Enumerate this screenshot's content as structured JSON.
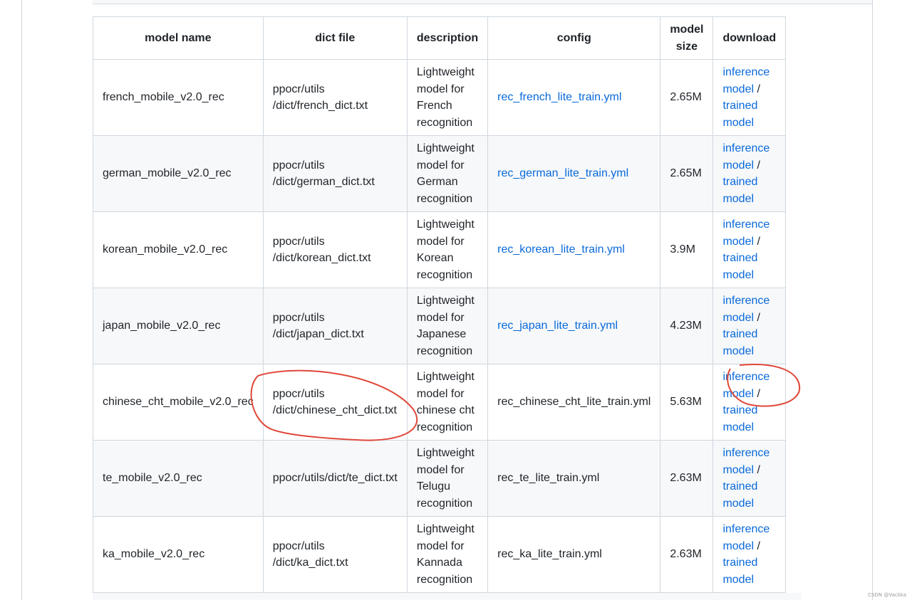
{
  "table": {
    "headers": {
      "model_name": "model name",
      "dict_file": "dict file",
      "description": "description",
      "config": "config",
      "model_size_1": "model",
      "model_size_2": "size",
      "download": "download"
    },
    "rows": [
      {
        "name": "french_mobile_v2.0_rec",
        "dict_1": "ppocr/utils",
        "dict_2": "/dict/french_dict.txt",
        "desc_1": "Lightweight",
        "desc_2": "model for",
        "desc_3": "French",
        "desc_4": "recognition",
        "config": "rec_french_lite_train.yml",
        "size": "2.65M",
        "dl_inference_1": "inference",
        "dl_inference_2": "model",
        "dl_sep": " /",
        "dl_trained_1": "trained",
        "dl_trained_2": "model"
      },
      {
        "name": "german_mobile_v2.0_rec",
        "dict_1": "ppocr/utils",
        "dict_2": "/dict/german_dict.txt",
        "desc_1": "Lightweight",
        "desc_2": "model for",
        "desc_3": "German",
        "desc_4": "recognition",
        "config": "rec_german_lite_train.yml",
        "size": "2.65M",
        "dl_inference_1": "inference",
        "dl_inference_2": "model",
        "dl_sep": " /",
        "dl_trained_1": "trained",
        "dl_trained_2": "model"
      },
      {
        "name": "korean_mobile_v2.0_rec",
        "dict_1": "ppocr/utils",
        "dict_2": "/dict/korean_dict.txt",
        "desc_1": "Lightweight",
        "desc_2": "model for",
        "desc_3": "Korean",
        "desc_4": "recognition",
        "config": "rec_korean_lite_train.yml",
        "size": "3.9M",
        "dl_inference_1": "inference",
        "dl_inference_2": "model",
        "dl_sep": " /",
        "dl_trained_1": "trained",
        "dl_trained_2": "model"
      },
      {
        "name": "japan_mobile_v2.0_rec",
        "dict_1": "ppocr/utils",
        "dict_2": "/dict/japan_dict.txt",
        "desc_1": "Lightweight",
        "desc_2": "model for",
        "desc_3": "Japanese",
        "desc_4": "recognition",
        "config": "rec_japan_lite_train.yml",
        "size": "4.23M",
        "dl_inference_1": "inference",
        "dl_inference_2": "model",
        "dl_sep": " /",
        "dl_trained_1": "trained",
        "dl_trained_2": "model"
      },
      {
        "name": "chinese_cht_mobile_v2.0_rec",
        "dict_1": "ppocr/utils",
        "dict_2": "/dict/chinese_cht_dict.txt",
        "desc_1": "Lightweight",
        "desc_2": "model for",
        "desc_3": "chinese cht",
        "desc_4": "recognition",
        "config": "rec_chinese_cht_lite_train.yml",
        "size": "5.63M",
        "dl_inference_1": "inference",
        "dl_inference_2": "model",
        "dl_sep": " /",
        "dl_trained_1": "trained",
        "dl_trained_2": "model"
      },
      {
        "name": "te_mobile_v2.0_rec",
        "dict_1": "ppocr/utils/dict/te_dict.txt",
        "dict_2": "",
        "desc_1": "Lightweight",
        "desc_2": "model for",
        "desc_3": "Telugu",
        "desc_4": "recognition",
        "config": "rec_te_lite_train.yml",
        "size": "2.63M",
        "dl_inference_1": "inference",
        "dl_inference_2": "model",
        "dl_sep": " /",
        "dl_trained_1": "trained",
        "dl_trained_2": "model"
      },
      {
        "name": "ka_mobile_v2.0_rec",
        "dict_1": "ppocr/utils",
        "dict_2": "/dict/ka_dict.txt",
        "desc_1": "Lightweight",
        "desc_2": "model for",
        "desc_3": "Kannada",
        "desc_4": "recognition",
        "config": "rec_ka_lite_train.yml",
        "size": "2.63M",
        "dl_inference_1": "inference",
        "dl_inference_2": "model",
        "dl_sep": " /",
        "dl_trained_1": "trained",
        "dl_trained_2": "model"
      }
    ]
  },
  "annotation": {
    "stroke_color": "#e0483a"
  },
  "colors": {
    "link": "#0969da",
    "border": "#d0d7de",
    "row_alt": "#f6f8fa"
  },
  "watermark": "CSDN @Vackka"
}
